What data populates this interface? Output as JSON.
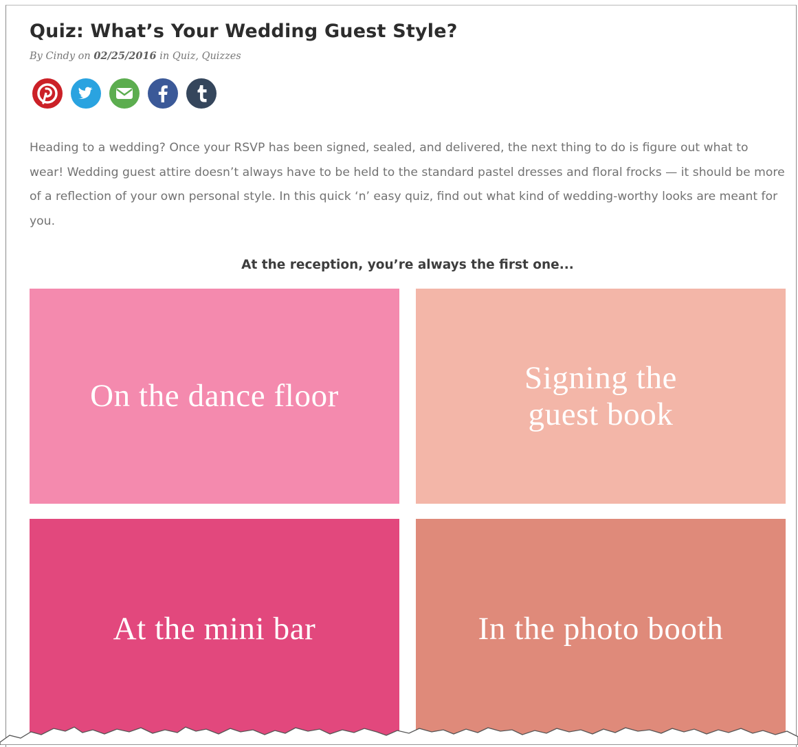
{
  "article": {
    "title": "Quiz: What’s Your Wedding Guest Style?",
    "byline": {
      "prefix": "By",
      "author": "Cindy",
      "on": "on",
      "date": "02/25/2016",
      "in": "in",
      "category1": "Quiz",
      "separator": ",",
      "category2": "Quizzes"
    },
    "intro": "Heading to a wedding? Once your RSVP has been signed, sealed, and delivered, the next thing to do is figure out what to wear! Wedding guest attire doesn’t always have to be held to the standard pastel dresses and floral frocks — it should be more of a reflection of your own personal style. In this quick ‘n’ easy quiz, find out what kind of wedding-worthy looks are meant for you."
  },
  "share": [
    {
      "icon": "pinterest-icon",
      "color": "#cb2027"
    },
    {
      "icon": "twitter-icon",
      "color": "#2aa3e0"
    },
    {
      "icon": "email-icon",
      "color": "#5cad4f"
    },
    {
      "icon": "facebook-icon",
      "color": "#3b5998"
    },
    {
      "icon": "tumblr-icon",
      "color": "#35465c"
    }
  ],
  "quiz": {
    "question": "At the reception, you’re always the first one...",
    "answers": [
      {
        "label": "On the dance floor",
        "color": "#f48aae"
      },
      {
        "label": "Signing the guest book",
        "color": "#f3b6a8"
      },
      {
        "label": "At the mini bar",
        "color": "#e2487d"
      },
      {
        "label": "In the photo booth",
        "color": "#df8a7a"
      }
    ]
  }
}
